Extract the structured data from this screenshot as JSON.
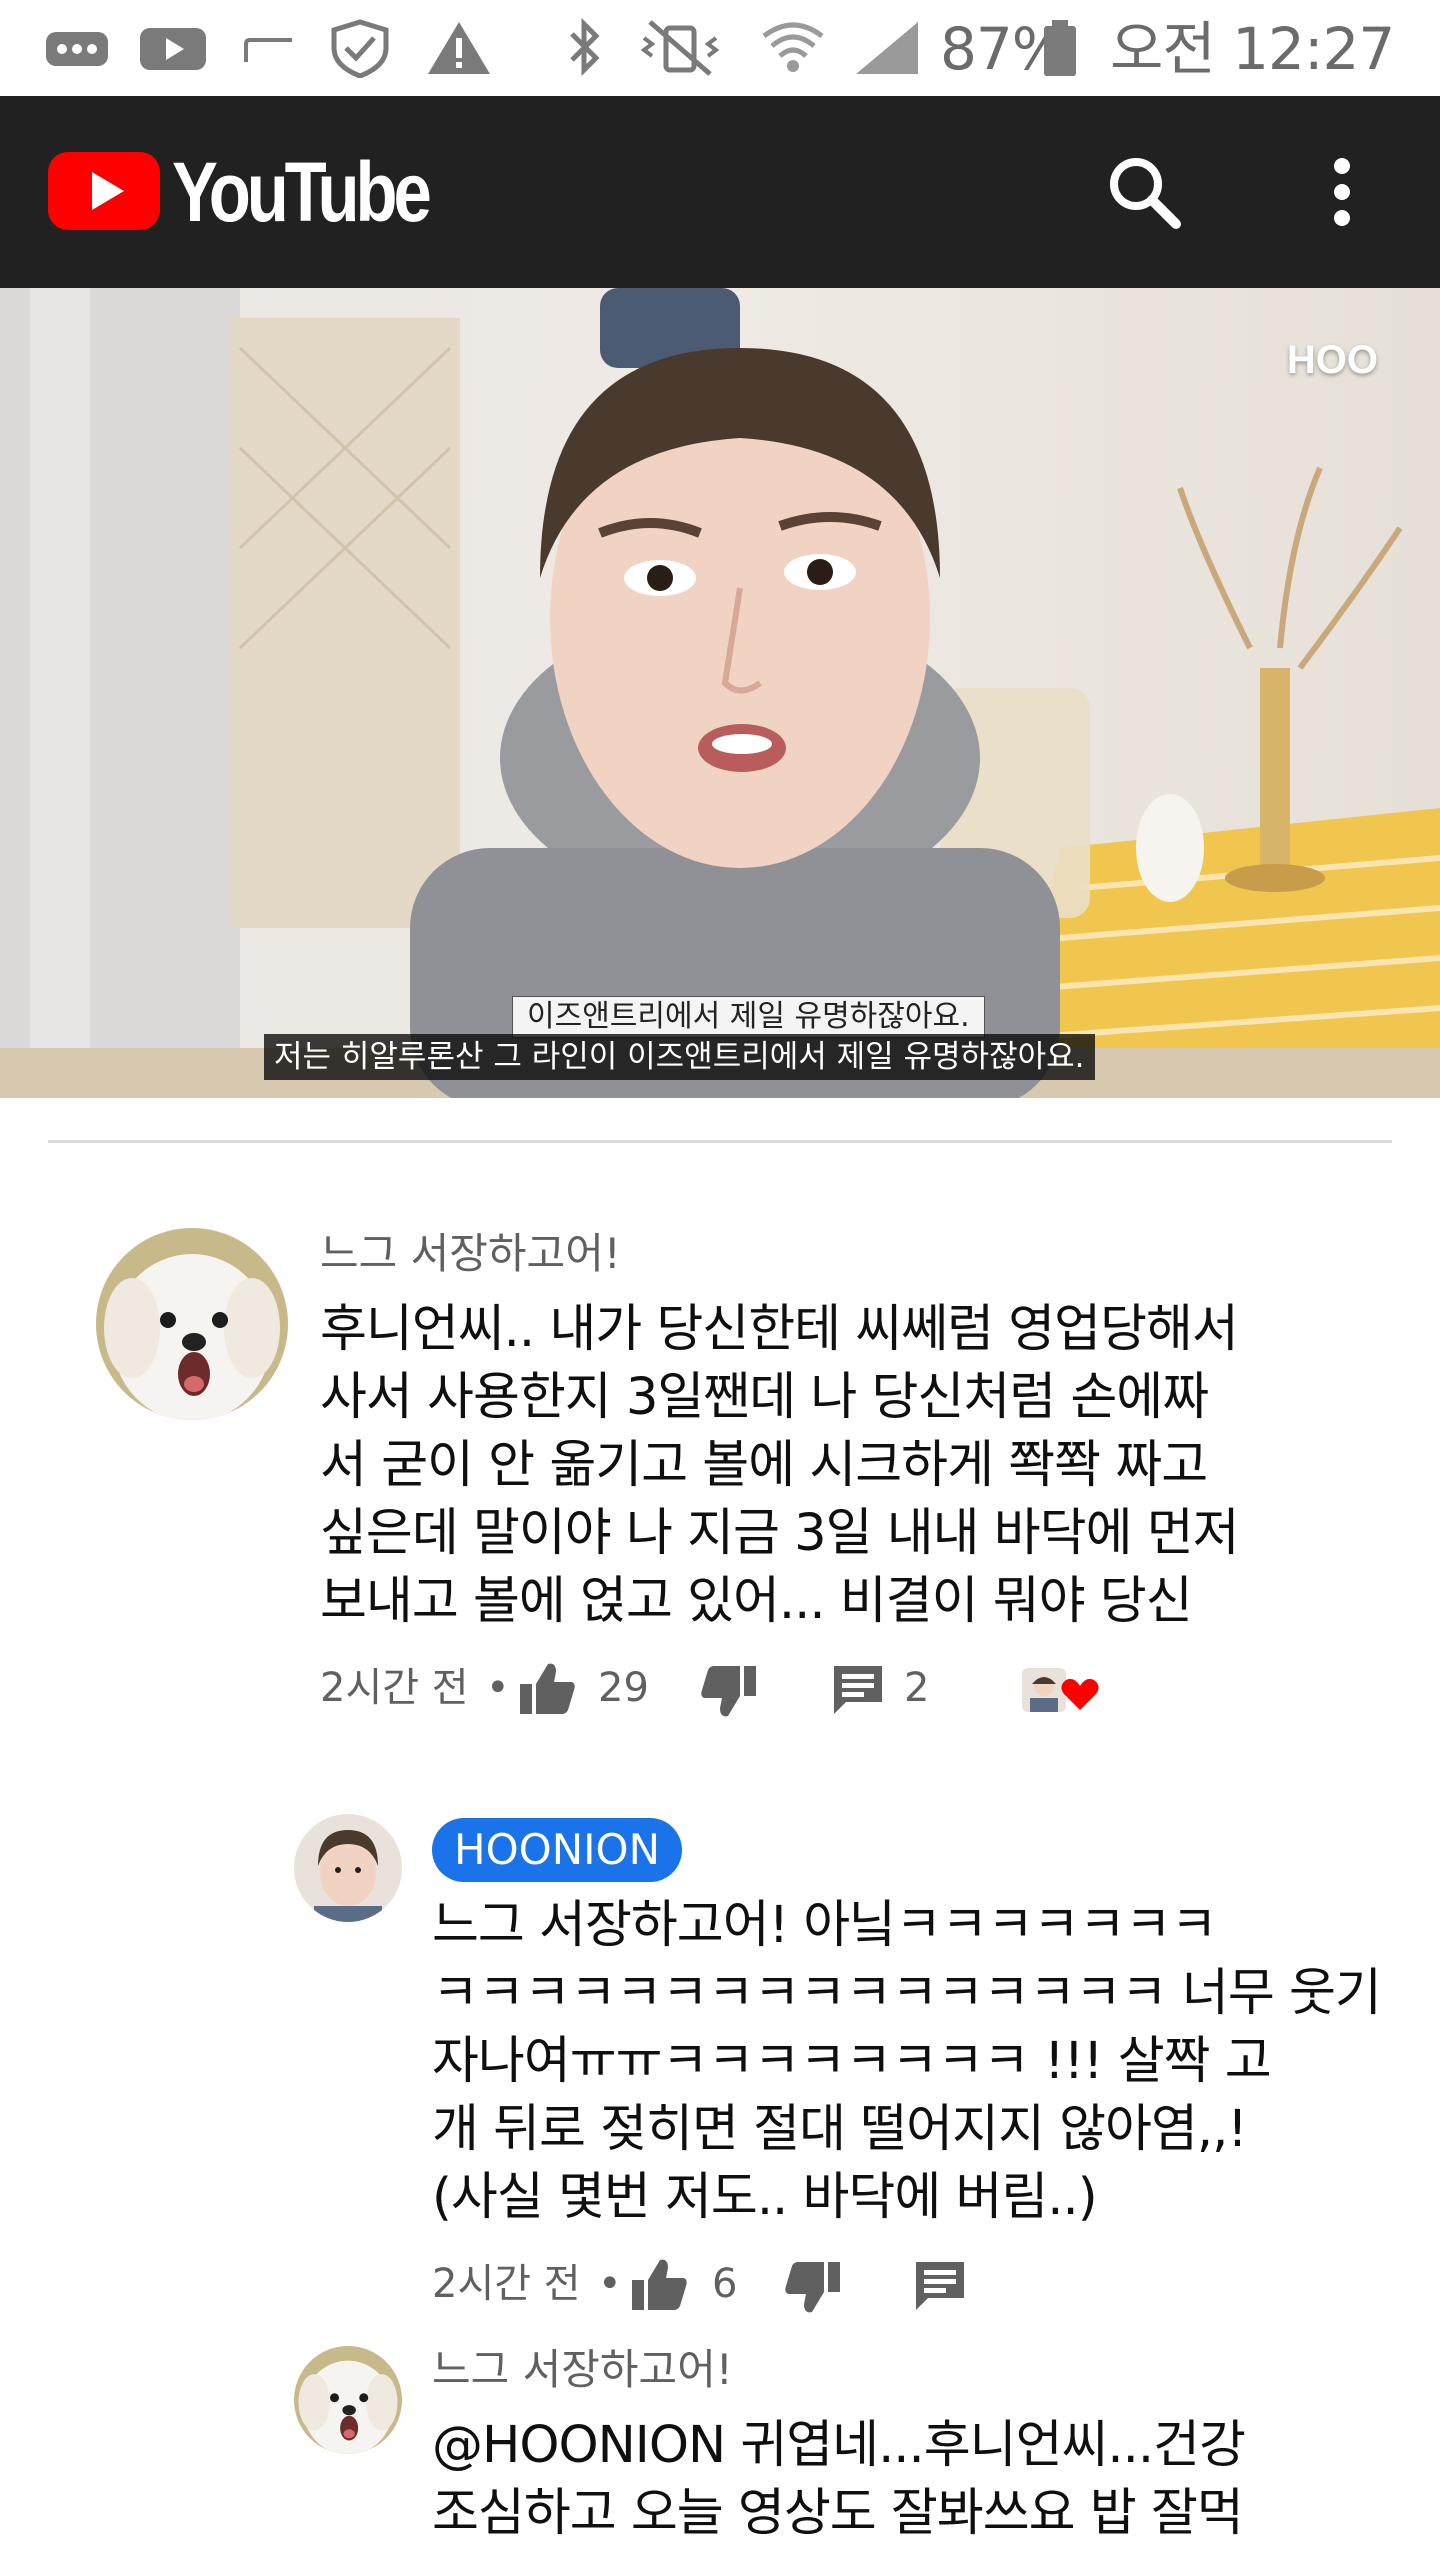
{
  "status_bar": {
    "battery": "87%",
    "time": "오전 12:27",
    "icons": [
      "chat-icon",
      "youtube-notification-icon",
      "cast-icon",
      "shield-check-icon",
      "warning-icon",
      "bluetooth-icon",
      "vibrate-off-icon",
      "wifi-icon",
      "signal-icon",
      "battery-icon"
    ]
  },
  "app_bar": {
    "brand": "YouTube",
    "icons": [
      "search-icon",
      "more-vert-icon"
    ],
    "colors": {
      "background": "#212121",
      "logo_red": "#ff0000"
    }
  },
  "video": {
    "watermark": "HOO",
    "burned_caption": "이즈앤트리에서 제일 유명하잖아요.",
    "caption": "저는 히알루론산 그 라인이 이즈앤트리에서 제일 유명하잖아요."
  },
  "comments": [
    {
      "author": "느그 서장하고어!",
      "avatar": "white-dog-avatar",
      "lines": [
        "후니언씨.. 내가 당신한테 씨쎄럼 영업당해서",
        "사서 사용한지 3일짼데 나 당신처럼 손에짜",
        "서 굳이 안 옮기고 볼에 시크하게 쫙쫙 짜고",
        "싶은데 말이야 나 지금 3일 내내 바닥에 먼저",
        "보내고 볼에 얹고 있어... 비결이 뭐야 당신"
      ],
      "time": "2시간 전",
      "separator": "•",
      "likes": "29",
      "replies": "2",
      "creator_heart": true
    }
  ],
  "replies": [
    {
      "author": "HOONION",
      "is_owner": true,
      "avatar": "hoonion-avatar",
      "lines": [
        "느그 서장하고어! 아닠ㅋㅋㅋㅋㅋㅋㅋ",
        "ㅋㅋㅋㅋㅋㅋㅋㅋㅋㅋㅋㅋㅋㅋㅋㅋ 너무 웃기",
        "자나여ㅠㅠㅋㅋㅋㅋㅋㅋㅋㅋ !!! 살짝 고",
        "개 뒤로 젖히면 절대 떨어지지 않아염,,!",
        "(사실 몇번 저도.. 바닥에 버림..)"
      ],
      "time": "2시간 전",
      "separator": "•",
      "likes": "6"
    },
    {
      "author": "느그 서장하고어!",
      "is_owner": false,
      "avatar": "white-dog-avatar",
      "lines": [
        "@HOONION 귀엽네...후니언씨...건강",
        "조심하고 오늘 영상도 잘봐쓰요 밥 잘먹"
      ]
    }
  ],
  "colors": {
    "owner_badge": "#1a73e8",
    "heart": "#ff0000",
    "meta_gray": "#606060"
  }
}
